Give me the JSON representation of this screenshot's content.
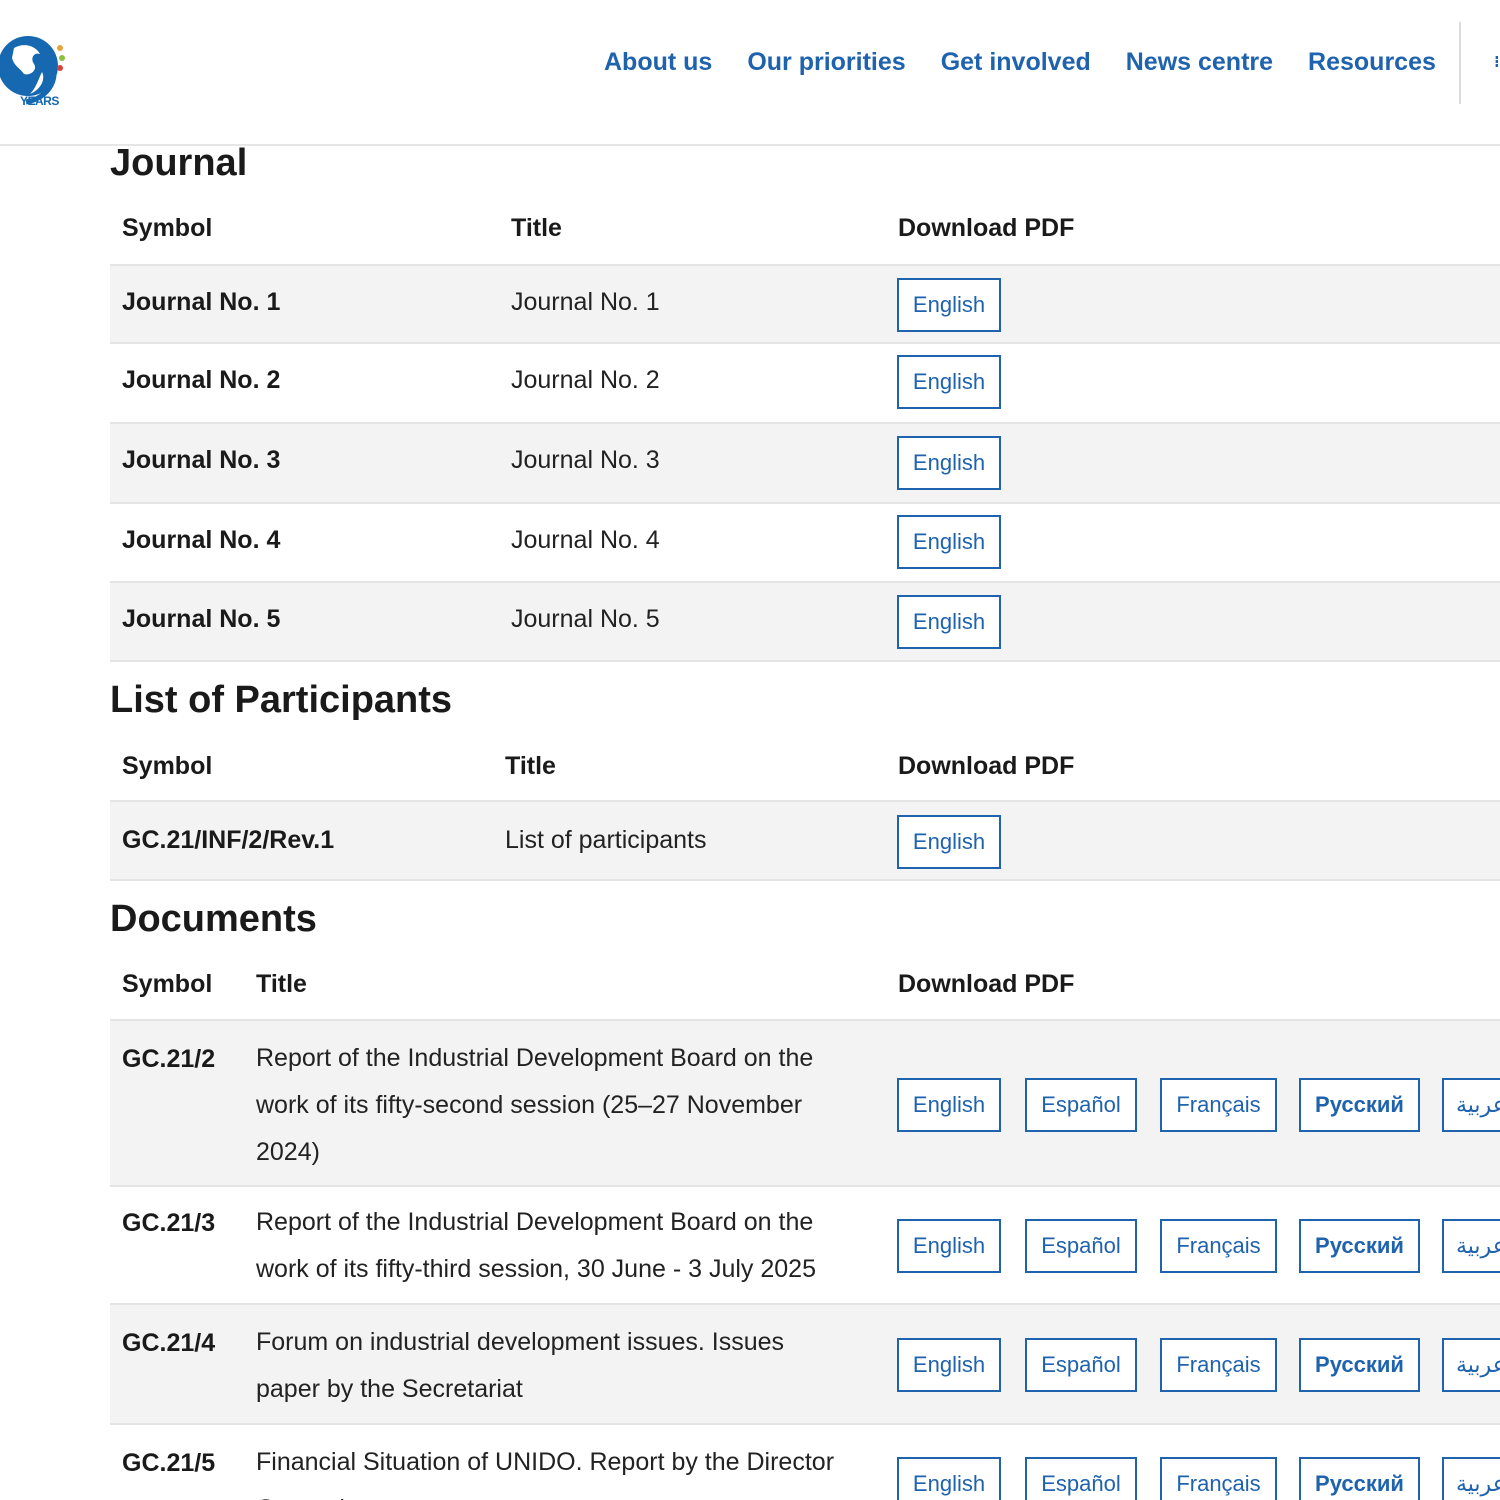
{
  "logo": {
    "years_text": "YEARS"
  },
  "nav": {
    "items": [
      "About us",
      "Our priorities",
      "Get involved",
      "News centre",
      "Resources"
    ]
  },
  "journal": {
    "title": "Journal",
    "headers": {
      "symbol": "Symbol",
      "title": "Title",
      "download": "Download PDF"
    },
    "rows": [
      {
        "symbol": "Journal No. 1",
        "title": "Journal No. 1",
        "langs": [
          "English"
        ]
      },
      {
        "symbol": "Journal No. 2",
        "title": "Journal No. 2",
        "langs": [
          "English"
        ]
      },
      {
        "symbol": "Journal No. 3",
        "title": "Journal No. 3",
        "langs": [
          "English"
        ]
      },
      {
        "symbol": "Journal No. 4",
        "title": "Journal No. 4",
        "langs": [
          "English"
        ]
      },
      {
        "symbol": "Journal No. 5",
        "title": "Journal No. 5",
        "langs": [
          "English"
        ]
      }
    ]
  },
  "participants": {
    "title": "List of Participants",
    "headers": {
      "symbol": "Symbol",
      "title": "Title",
      "download": "Download PDF"
    },
    "rows": [
      {
        "symbol": "GC.21/INF/2/Rev.1",
        "title": "List of participants",
        "langs": [
          "English"
        ]
      }
    ]
  },
  "documents": {
    "title": "Documents",
    "headers": {
      "symbol": "Symbol",
      "title": "Title",
      "download": "Download PDF"
    },
    "languages": [
      "English",
      "Español",
      "Français",
      "Русский",
      "عربية"
    ],
    "rows": [
      {
        "symbol": "GC.21/2",
        "title": "Report of the Industrial Development Board on the work of its fifty-second session (25–27 November 2024)"
      },
      {
        "symbol": "GC.21/3",
        "title": "Report of the Industrial Development Board on the work of its fifty-third session, 30 June - 3 July 2025"
      },
      {
        "symbol": "GC.21/4",
        "title": "Forum on industrial development issues. Issues paper by the Secretariat"
      },
      {
        "symbol": "GC.21/5",
        "title": "Financial Situation of UNIDO. Report by the Director General"
      }
    ]
  },
  "colors": {
    "accent": "#1f62ae",
    "row_shade": "#f3f3f3",
    "divider": "#e4e4e4"
  }
}
